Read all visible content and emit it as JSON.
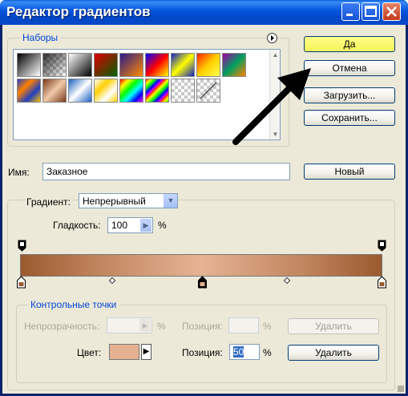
{
  "window": {
    "title": "Редактор градиентов",
    "minimize_icon": "minimize-icon",
    "maximize_icon": "maximize-icon",
    "close_icon": "close-icon"
  },
  "presets": {
    "label": "Наборы",
    "menu_icon": "circle-arrow-icon"
  },
  "buttons": {
    "ok": "Да",
    "cancel": "Отмена",
    "load": "Загрузить...",
    "save": "Сохранить...",
    "new": "Новый"
  },
  "name": {
    "label": "Имя:",
    "value": "Заказное"
  },
  "gradient": {
    "type_label": "Градиент:",
    "type_value": "Непрерывный",
    "smoothness_label": "Гладкость:",
    "smoothness_value": "100",
    "smoothness_unit": "%",
    "start_color": "#9a5a2e",
    "mid_color": "#e5b394",
    "end_color": "#9a5a2e"
  },
  "stops": {
    "group_label": "Контрольные точки",
    "opacity_label": "Непрозрачность:",
    "opacity_unit": "%",
    "opacity_position_label": "Позиция:",
    "opacity_position_unit": "%",
    "opacity_delete": "Удалить",
    "color_label": "Цвет:",
    "color_value": "#e4b191",
    "color_position_label": "Позиция:",
    "color_position_value": "50",
    "color_position_unit": "%",
    "color_delete": "Удалить"
  }
}
